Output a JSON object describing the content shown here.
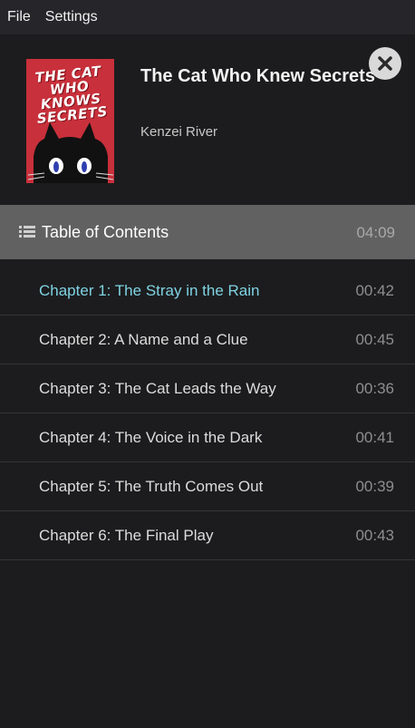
{
  "menubar": {
    "items": [
      "File",
      "Settings"
    ]
  },
  "book": {
    "title": "The Cat Who Knew Secrets",
    "author": "Kenzei River",
    "cover_text": "THE CAT WHO KNOWS SECRETS",
    "cover_color": "#c8303b"
  },
  "close_icon": "close-icon",
  "toc": {
    "title": "Table of Contents",
    "total_time": "04:09",
    "icon": "list-icon"
  },
  "chapters": [
    {
      "label": "Chapter 1: The Stray in the Rain",
      "time": "00:42",
      "active": true
    },
    {
      "label": "Chapter 2: A Name and a Clue",
      "time": "00:45",
      "active": false
    },
    {
      "label": "Chapter 3: The Cat Leads the Way",
      "time": "00:36",
      "active": false
    },
    {
      "label": "Chapter 4: The Voice in the Dark",
      "time": "00:41",
      "active": false
    },
    {
      "label": "Chapter 5: The Truth Comes Out",
      "time": "00:39",
      "active": false
    },
    {
      "label": "Chapter 6: The Final Play",
      "time": "00:43",
      "active": false
    }
  ],
  "colors": {
    "accent": "#7fd3e2",
    "background": "#1c1c1e",
    "toc_header": "#616161"
  }
}
